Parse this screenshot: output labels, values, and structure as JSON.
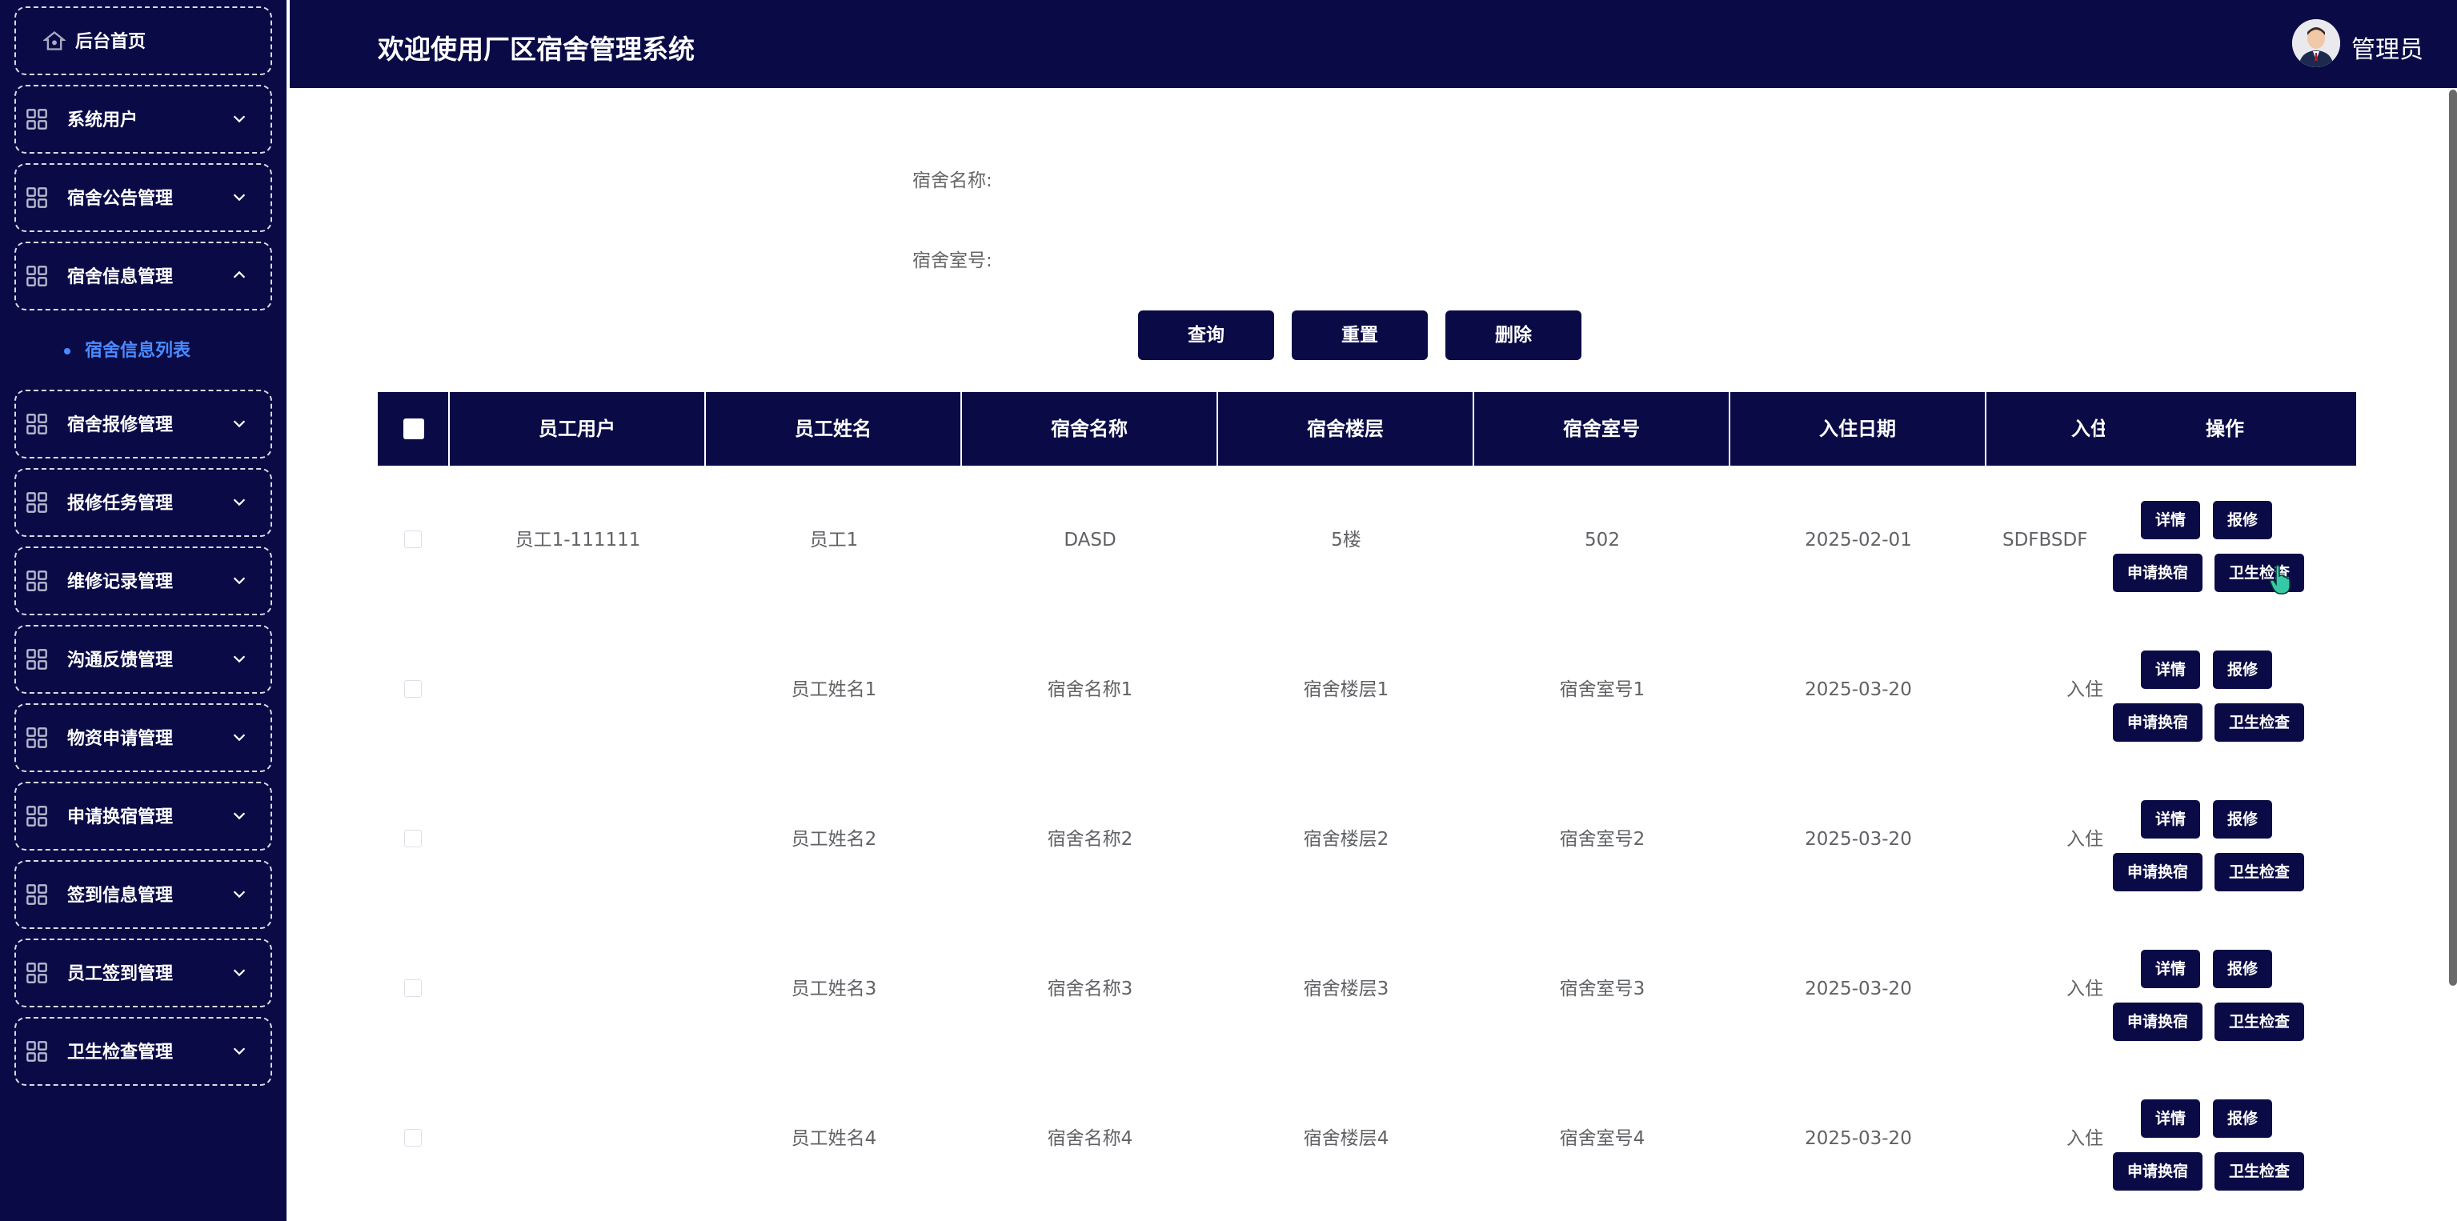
{
  "sidebar": {
    "home": {
      "label": "后台首页",
      "icon": "home-icon"
    },
    "menus": [
      {
        "label": "系统用户",
        "icon": "grid-icon",
        "expanded": false
      },
      {
        "label": "宿舍公告管理",
        "icon": "grid-icon",
        "expanded": false
      },
      {
        "label": "宿舍信息管理",
        "icon": "grid-icon",
        "expanded": true
      },
      {
        "label": "宿舍报修管理",
        "icon": "grid-icon",
        "expanded": false
      },
      {
        "label": "报修任务管理",
        "icon": "grid-icon",
        "expanded": false
      },
      {
        "label": "维修记录管理",
        "icon": "grid-icon",
        "expanded": false
      },
      {
        "label": "沟通反馈管理",
        "icon": "grid-icon",
        "expanded": false
      },
      {
        "label": "物资申请管理",
        "icon": "grid-icon",
        "expanded": false
      },
      {
        "label": "申请换宿管理",
        "icon": "grid-icon",
        "expanded": false
      },
      {
        "label": "签到信息管理",
        "icon": "grid-icon",
        "expanded": false
      },
      {
        "label": "员工签到管理",
        "icon": "grid-icon",
        "expanded": false
      },
      {
        "label": "卫生检查管理",
        "icon": "grid-icon",
        "expanded": false
      }
    ],
    "active_sub": "宿舍信息列表"
  },
  "header": {
    "title": "欢迎使用厂区宿舍管理系统",
    "user": "管理员"
  },
  "search": {
    "name_label": "宿舍名称:",
    "name_value": "",
    "room_label": "宿舍室号:",
    "room_value": "",
    "query_btn": "查询",
    "reset_btn": "重置",
    "delete_btn": "删除"
  },
  "table": {
    "headers": [
      "员工用户",
      "员工姓名",
      "宿舍名称",
      "宿舍楼层",
      "宿舍室号",
      "入住日期",
      "入住",
      "操作"
    ],
    "rows": [
      {
        "user": "员工1-111111",
        "name": "员工1",
        "dorm": "DASD",
        "floor": "5楼",
        "room": "502",
        "date": "2025-02-01",
        "extra": "SDFBSDF"
      },
      {
        "user": "",
        "name": "员工姓名1",
        "dorm": "宿舍名称1",
        "floor": "宿舍楼层1",
        "room": "宿舍室号1",
        "date": "2025-03-20",
        "extra": "入住"
      },
      {
        "user": "",
        "name": "员工姓名2",
        "dorm": "宿舍名称2",
        "floor": "宿舍楼层2",
        "room": "宿舍室号2",
        "date": "2025-03-20",
        "extra": "入住"
      },
      {
        "user": "",
        "name": "员工姓名3",
        "dorm": "宿舍名称3",
        "floor": "宿舍楼层3",
        "room": "宿舍室号3",
        "date": "2025-03-20",
        "extra": "入住"
      },
      {
        "user": "",
        "name": "员工姓名4",
        "dorm": "宿舍名称4",
        "floor": "宿舍楼层4",
        "room": "宿舍室号4",
        "date": "2025-03-20",
        "extra": "入住"
      }
    ],
    "actions": {
      "detail": "详情",
      "repair": "报修",
      "change": "申请换宿",
      "hygiene": "卫生检查"
    }
  },
  "colors": {
    "navy": "#0a0b46",
    "accent": "#4a8bff"
  }
}
